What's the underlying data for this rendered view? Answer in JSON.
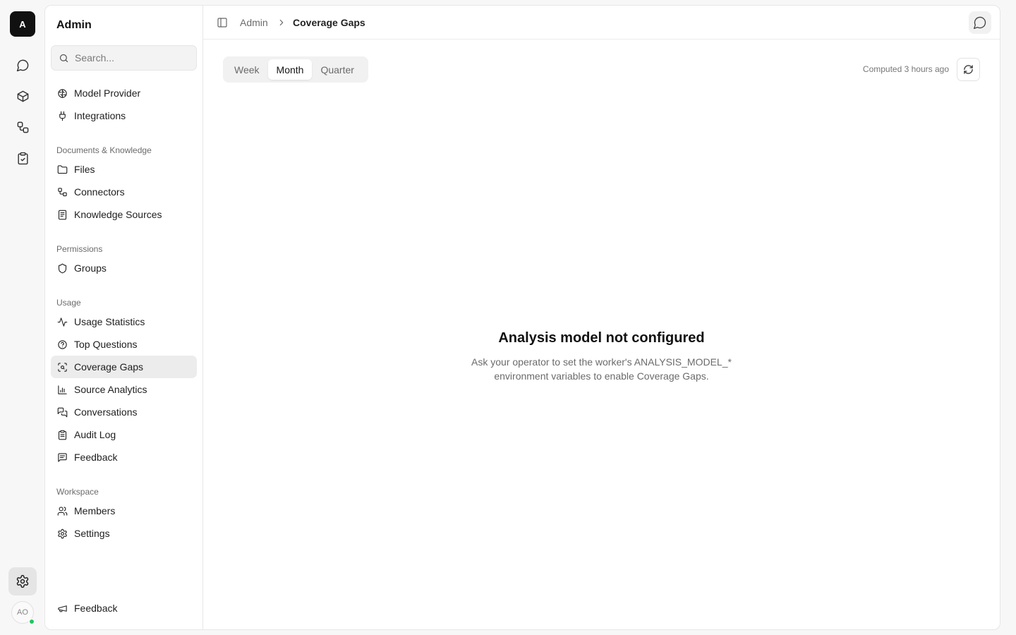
{
  "rail": {
    "logo": "A",
    "avatar_initials": "AO"
  },
  "sidebar": {
    "title": "Admin",
    "search_placeholder": "Search...",
    "top_items": [
      {
        "label": "Model Provider",
        "icon": "brain-icon"
      },
      {
        "label": "Integrations",
        "icon": "plug-icon"
      }
    ],
    "sections": [
      {
        "label": "Documents & Knowledge",
        "items": [
          {
            "label": "Files",
            "icon": "folder-icon"
          },
          {
            "label": "Connectors",
            "icon": "connectors-icon"
          },
          {
            "label": "Knowledge Sources",
            "icon": "book-icon"
          }
        ]
      },
      {
        "label": "Permissions",
        "items": [
          {
            "label": "Groups",
            "icon": "shield-icon"
          }
        ]
      },
      {
        "label": "Usage",
        "items": [
          {
            "label": "Usage Statistics",
            "icon": "activity-icon"
          },
          {
            "label": "Top Questions",
            "icon": "question-icon"
          },
          {
            "label": "Coverage Gaps",
            "icon": "scan-icon",
            "active": true
          },
          {
            "label": "Source Analytics",
            "icon": "bar-chart-icon"
          },
          {
            "label": "Conversations",
            "icon": "messages-icon"
          },
          {
            "label": "Audit Log",
            "icon": "clipboard-icon"
          },
          {
            "label": "Feedback",
            "icon": "message-square-icon"
          }
        ]
      },
      {
        "label": "Workspace",
        "items": [
          {
            "label": "Members",
            "icon": "users-icon"
          },
          {
            "label": "Settings",
            "icon": "gear-icon"
          }
        ]
      }
    ],
    "footer_item": {
      "label": "Feedback",
      "icon": "megaphone-icon"
    }
  },
  "topbar": {
    "breadcrumb_root": "Admin",
    "breadcrumb_current": "Coverage Gaps"
  },
  "period_tabs": [
    {
      "label": "Week",
      "active": false
    },
    {
      "label": "Month",
      "active": true
    },
    {
      "label": "Quarter",
      "active": false
    }
  ],
  "computed_text": "Computed 3 hours ago",
  "empty_state": {
    "title": "Analysis model not configured",
    "line1": "Ask your operator to set the worker's ANALYSIS_MODEL_*",
    "line2": "environment variables to enable Coverage Gaps."
  }
}
